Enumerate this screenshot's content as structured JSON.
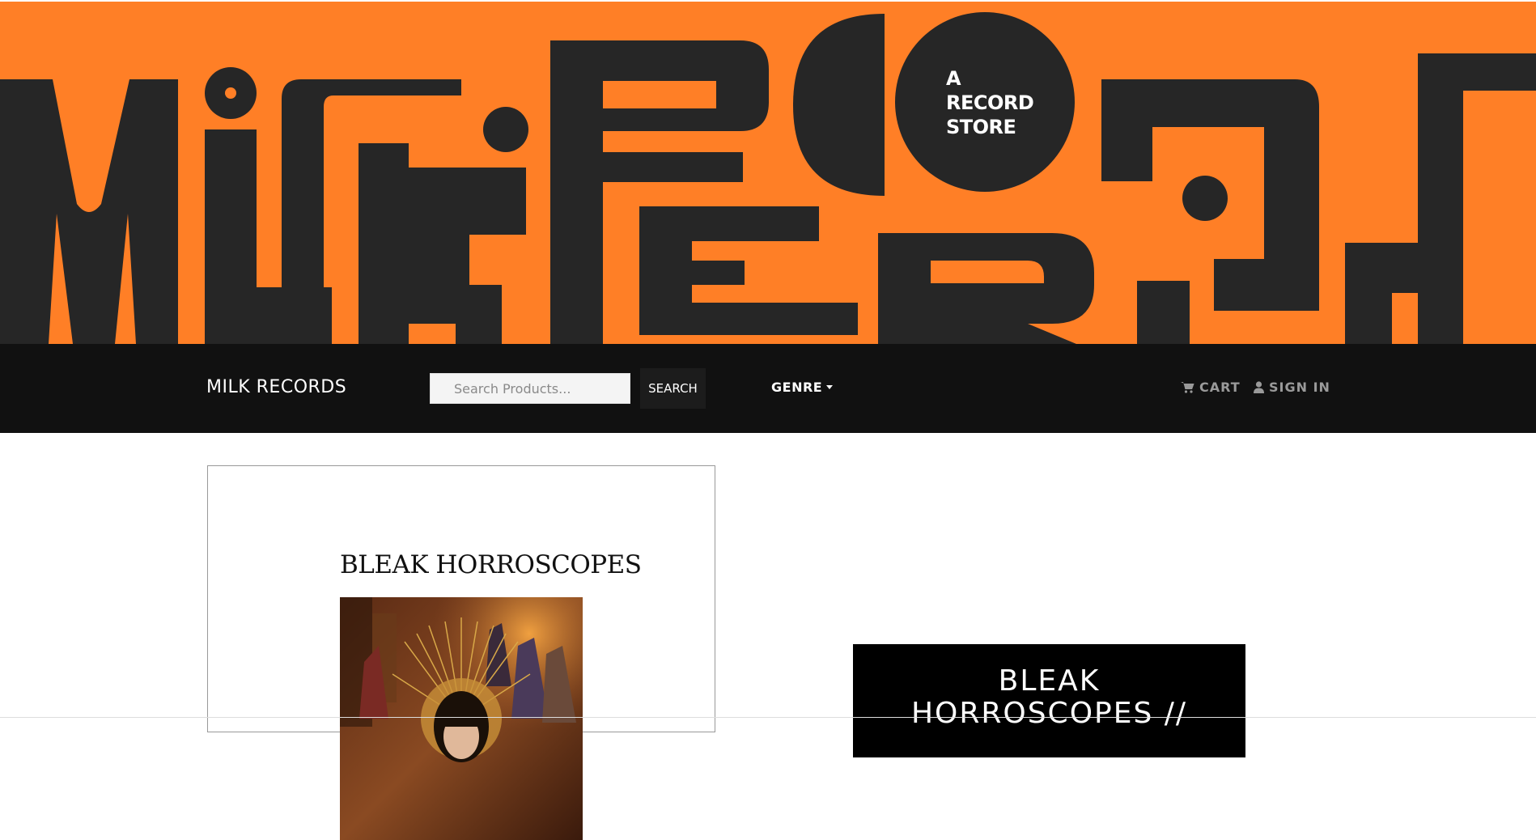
{
  "hero": {
    "tagline": [
      "A",
      "RECORD",
      "STORE"
    ],
    "logo_icon": "milk-records-logo",
    "background_color": "#ff7f26",
    "shape_color": "#262626"
  },
  "navbar": {
    "brand": "MILK RECORDS",
    "search_placeholder": "Search Products...",
    "search_button": "SEARCH",
    "genre_label": "GENRE",
    "cart_label": "CART",
    "cart_icon": "shopping-cart-icon",
    "signin_label": "SIGN IN",
    "signin_icon": "user-icon",
    "background_color": "#111111"
  },
  "product_card": {
    "title": "BLEAK HORROSCOPES",
    "image_icon": "album-cover-image"
  },
  "feature": {
    "title_line1": "BLEAK",
    "title_line2": "HORROSCOPES //"
  }
}
